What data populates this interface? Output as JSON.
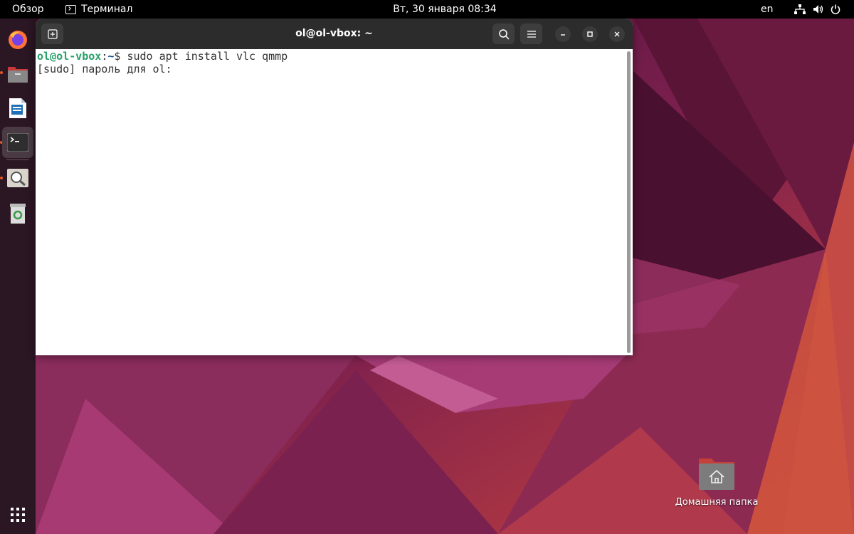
{
  "topbar": {
    "activities": "Обзор",
    "app_menu": "Терминал",
    "clock": "Вт, 30 января  08:34",
    "keyboard_layout": "en",
    "status_icons": [
      "network-icon",
      "volume-icon",
      "power-icon"
    ]
  },
  "dock": {
    "items": [
      {
        "name": "firefox",
        "icon": "firefox-icon",
        "running": false
      },
      {
        "name": "files",
        "icon": "files-icon",
        "running": true
      },
      {
        "name": "libreoffice-writer",
        "icon": "writer-icon",
        "running": false
      },
      {
        "name": "terminal",
        "icon": "terminal-icon",
        "running": true,
        "active": true
      },
      {
        "name": "image-viewer",
        "icon": "magnifier-icon",
        "running": true
      },
      {
        "name": "trash",
        "icon": "trash-icon",
        "running": false
      }
    ],
    "show_apps_icon": "grid-icon"
  },
  "window": {
    "title": "ol@ol-vbox: ~",
    "new_tab_icon": "new-tab-icon",
    "search_icon": "search-icon",
    "menu_icon": "hamburger-menu-icon",
    "minimize_icon": "minimize-icon",
    "maximize_icon": "maximize-icon",
    "close_icon": "close-icon"
  },
  "terminal": {
    "prompt_user": "ol@ol-vbox",
    "prompt_sep": ":",
    "prompt_path": "~",
    "prompt_symbol": "$ ",
    "command": "sudo apt install vlc qmmp",
    "output_line": "[sudo] пароль для ol: "
  },
  "desktop": {
    "home_folder_label": "Домашняя папка"
  },
  "colors": {
    "accent": "#e95420",
    "prompt_user": "#26a269",
    "prompt_path": "#12488b",
    "headerbar": "#2c2c2c",
    "topbar": "#000000"
  }
}
